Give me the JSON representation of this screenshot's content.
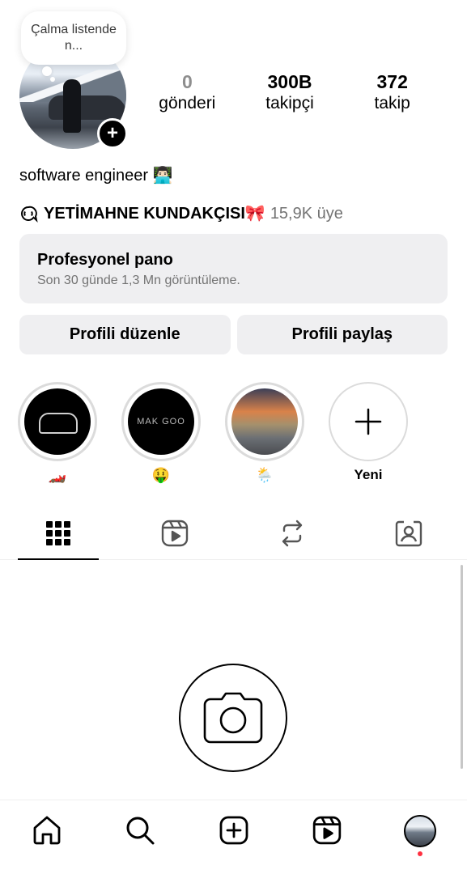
{
  "profile": {
    "note": "Çalma listende n...",
    "stats": [
      {
        "value": "0",
        "label": "gönderi"
      },
      {
        "value": "300B",
        "label": "takipçi"
      },
      {
        "value": "372",
        "label": "takip"
      }
    ],
    "bio": "software engineer 👨🏻‍💻",
    "channel": {
      "name": "YETİMAHNE KUNDAKÇISI🎀",
      "members": "15,9K üye"
    }
  },
  "dashboard": {
    "title": "Profesyonel pano",
    "subtitle": "Son 30 günde 1,3 Mn görüntüleme."
  },
  "buttons": {
    "edit": "Profili düzenle",
    "share": "Profili paylaş"
  },
  "highlights": [
    {
      "label": "🏎️",
      "image": "car-drawing"
    },
    {
      "label": "🤑",
      "image": "text-logo",
      "image_text": "MAK GOO"
    },
    {
      "label": "🌦️",
      "image": "sunset-road"
    },
    {
      "label": "Yeni",
      "image": "plus-icon"
    }
  ],
  "tabs": [
    {
      "icon": "grid-icon",
      "active": true
    },
    {
      "icon": "reels-icon",
      "active": false
    },
    {
      "icon": "repost-icon",
      "active": false
    },
    {
      "icon": "tagged-icon",
      "active": false
    }
  ],
  "empty_state_icon": "camera-icon",
  "bottom_nav": [
    {
      "icon": "home-icon"
    },
    {
      "icon": "search-icon"
    },
    {
      "icon": "create-icon"
    },
    {
      "icon": "reels-icon"
    },
    {
      "icon": "profile-avatar",
      "notification_dot": true
    }
  ],
  "colors": {
    "secondary_text": "#737373",
    "button_bg": "#efeff1",
    "notification": "#ff3040"
  }
}
